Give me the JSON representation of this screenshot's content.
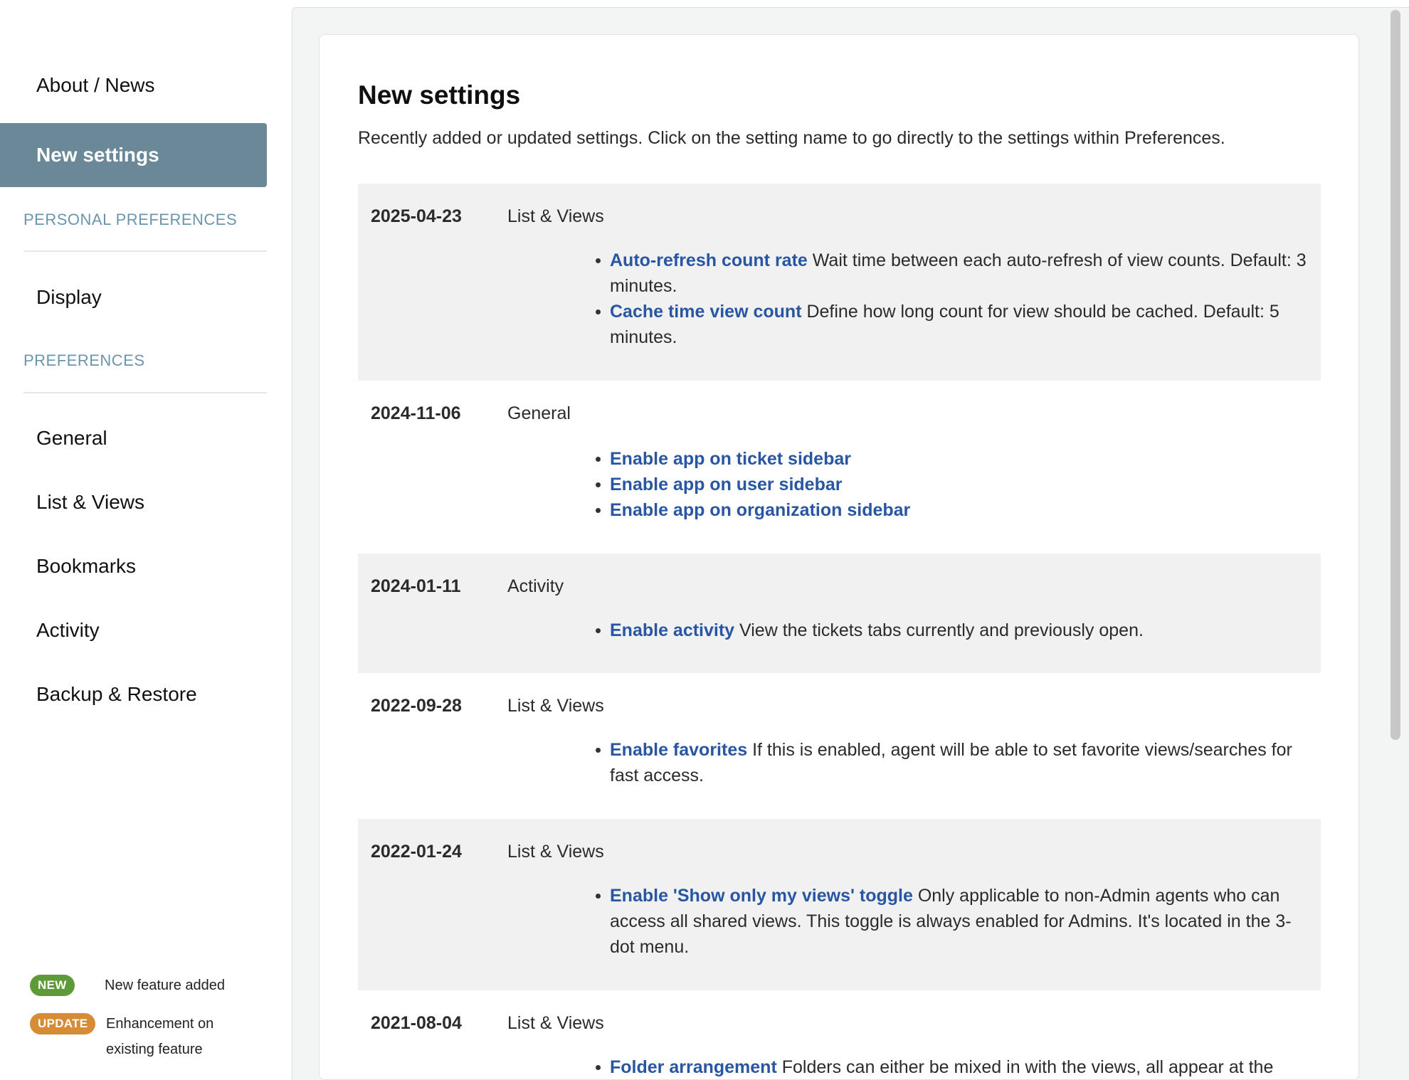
{
  "sidebar": {
    "nav_top": [
      {
        "label": "About / News"
      },
      {
        "label": "New settings"
      }
    ],
    "personal_label": "PERSONAL PREFERENCES",
    "personal_items": [
      {
        "label": "Display"
      }
    ],
    "preferences_label": "PREFERENCES",
    "preference_items": [
      {
        "label": "General"
      },
      {
        "label": "List & Views"
      },
      {
        "label": "Bookmarks"
      },
      {
        "label": "Activity"
      },
      {
        "label": "Backup & Restore"
      }
    ],
    "legend": {
      "new_badge": "NEW",
      "new_text": "New feature added",
      "update_badge": "UPDATE",
      "update_text_line1": "Enhancement on",
      "update_text_line2": "existing feature"
    }
  },
  "main": {
    "title": "New settings",
    "description": "Recently added or updated settings. Click on the setting name to go directly to the settings within Preferences.",
    "entries": [
      {
        "date": "2025-04-23",
        "category": "List & Views",
        "items": [
          {
            "name": "Auto-refresh count rate",
            "desc": " Wait time between each auto-refresh of view counts. Default: 3 minutes."
          },
          {
            "name": "Cache time view count",
            "desc": " Define how long count for view should be cached. Default: 5 minutes."
          }
        ]
      },
      {
        "date": "2024-11-06",
        "category": "General",
        "items": [
          {
            "name": "Enable app on ticket sidebar",
            "desc": ""
          },
          {
            "name": "Enable app on user sidebar",
            "desc": ""
          },
          {
            "name": "Enable app on organization sidebar",
            "desc": ""
          }
        ]
      },
      {
        "date": "2024-01-11",
        "category": "Activity",
        "items": [
          {
            "name": "Enable activity",
            "desc": " View the tickets tabs currently and previously open."
          }
        ]
      },
      {
        "date": "2022-09-28",
        "category": "List & Views",
        "items": [
          {
            "name": "Enable favorites",
            "desc": " If this is enabled, agent will be able to set favorite views/searches for fast access."
          }
        ]
      },
      {
        "date": "2022-01-24",
        "category": "List & Views",
        "items": [
          {
            "name": "Enable 'Show only my views' toggle",
            "desc": " Only applicable to non-Admin agents who can access all shared views. This toggle is always enabled for Admins. It's located in the 3-dot menu."
          }
        ]
      },
      {
        "date": "2021-08-04",
        "category": "List & Views",
        "items": [
          {
            "name": "Folder arrangement",
            "desc": " Folders can either be mixed in with the views, all appear at the"
          }
        ]
      }
    ]
  },
  "colors": {
    "active_nav": "#6a8898",
    "section_label": "#6b95ad",
    "link": "#2856a3",
    "new_badge": "#5e9a37",
    "update_badge": "#d68b35",
    "shaded_row": "#f1f1f1"
  }
}
